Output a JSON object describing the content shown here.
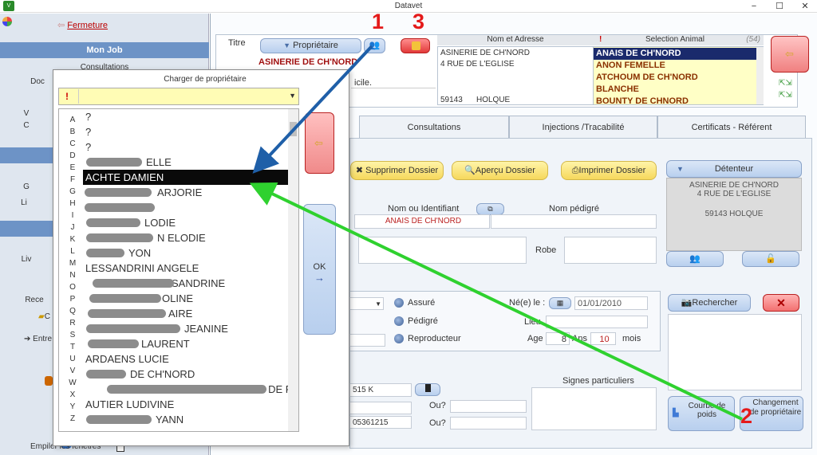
{
  "window": {
    "title": "Datavet",
    "min": "−",
    "max": "☐",
    "close": "✕"
  },
  "sidebar": {
    "close_label": "Fermeture",
    "section_mon_job": "Mon Job",
    "items": [
      "Consultations",
      "Doc",
      "V",
      "C",
      "Li",
      "G",
      "Liv",
      "Rece",
      "C",
      "Entre"
    ],
    "footer_label": "Empiler les fenêtres"
  },
  "owner": {
    "titre_label": "Titre",
    "proprietaire_button": "Propriétaire",
    "name": "ASINERIE DE CH'NORD",
    "partial_label": "icile.",
    "nom_adresse_header": "Nom et Adresse",
    "address_line1": "ASINERIE DE CH'NORD",
    "address_line2": "4 RUE DE L'EGLISE",
    "postal_code": "59143",
    "city": "HOLQUE"
  },
  "animal_selection": {
    "header": "Selection Animal",
    "count": "(54)",
    "exclamation": "!",
    "items": [
      "ANAIS DE CH'NORD",
      "ANON FEMELLE",
      "ATCHOUM DE CH'NORD",
      "BLANCHE",
      "BOUNTY DE CHNORD"
    ]
  },
  "tabs": [
    "Consultations",
    "Injections /Tracabilité",
    "Certificats - Référent"
  ],
  "actions": {
    "delete": "Supprimer Dossier",
    "preview": "Aperçu Dossier",
    "print": "Imprimer Dossier"
  },
  "detenteur": {
    "button": "Détenteur",
    "line1": "ASINERIE DE CH'NORD",
    "line2": "4 RUE DE L'EGLISE",
    "line3": "59143 HOLQUE"
  },
  "animal": {
    "nom_label": "Nom ou Identifiant",
    "nom_value": "ANAIS DE CH'NORD",
    "pedigree_label": "Nom pédigré",
    "robe_label": "Robe",
    "assure": "Assuré",
    "pedigre": "Pédigré",
    "reproducteur": "Reproducteur",
    "ne_le_label": "Né(e) le :",
    "birth_date": "01/01/2010",
    "lieu_label": "Lieu",
    "age_label": "Age",
    "age_years": "8",
    "ans_label": "Ans",
    "age_months": "10",
    "mois_label": "mois",
    "signes_label": "Signes particuliers",
    "id_partial": "515 K",
    "phone_partial": "05361215",
    "ou1": "Ou?",
    "ou2": "Ou?",
    "rechercher": "Rechercher",
    "courbe_poids": "Courbe de poids",
    "changement": "Changement de propriétaire"
  },
  "dialog": {
    "title": "Charger de propriétaire",
    "exclamation": "!",
    "ok_label": "OK",
    "ok_arrow": "→",
    "letters": [
      "A",
      "B",
      "C",
      "D",
      "E",
      "F",
      "G",
      "H",
      "I",
      "J",
      "K",
      "L",
      "M",
      "N",
      "O",
      "P",
      "Q",
      "R",
      "S",
      "T",
      "U",
      "V",
      "W",
      "X",
      "Y",
      "Z"
    ],
    "rows": [
      "?",
      "?",
      "?",
      "ELLE",
      "ACHTE DAMIEN",
      "ARJORIE",
      "",
      "LODIE",
      "N ELODIE",
      "YON",
      "LESSANDRINI ANGELE",
      "SANDRINE",
      "OLINE",
      "AIRE",
      "JEANINE",
      "LAURENT",
      "ARDAENS LUCIE",
      "DE CH'NORD",
      "ME DE RUBROUCK",
      "AUTIER LUDIVINE",
      "YANN"
    ]
  },
  "annotations": {
    "n1": "1",
    "n2": "2",
    "n3": "3"
  }
}
